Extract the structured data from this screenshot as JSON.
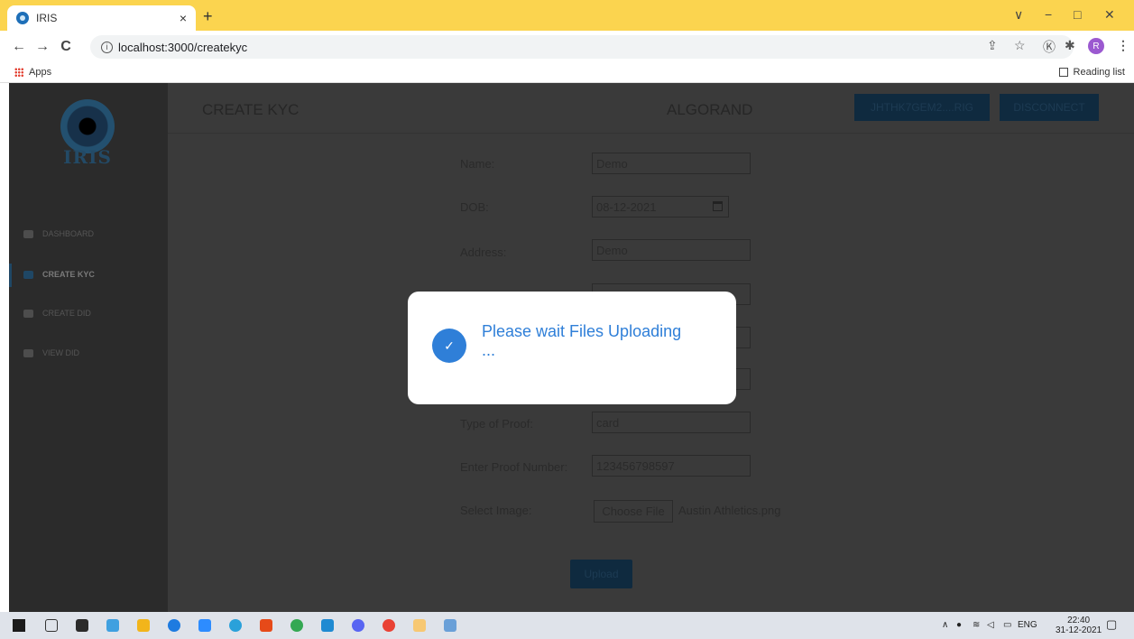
{
  "browser": {
    "tab_title": "IRIS",
    "tab_close": "×",
    "new_tab": "+",
    "url": "localhost:3000/createkyc",
    "nav": {
      "back": "←",
      "forward": "→",
      "reload": "C"
    },
    "window_controls": {
      "chevron": "∨",
      "minimize": "−",
      "restore": "□",
      "close": "✕"
    },
    "toolbar_icons": [
      "share-icon",
      "star-icon",
      "extension-icon",
      "puzzle-icon"
    ],
    "profile_initial": "R",
    "menu": "⋮",
    "bookmarks": {
      "apps_label": "Apps",
      "reading_list_label": "Reading list"
    }
  },
  "app": {
    "logo_text": "IRIS",
    "sidebar": {
      "items": [
        {
          "label": "DASHBOARD",
          "active": false
        },
        {
          "label": "CREATE KYC",
          "active": true
        },
        {
          "label": "CREATE DID",
          "active": false
        },
        {
          "label": "VIEW DID",
          "active": false
        }
      ]
    },
    "header": {
      "title": "CREATE KYC",
      "network": "ALGORAND",
      "address_button": "JHTHK7GEM2....RIG",
      "disconnect_button": "DISCONNECT"
    },
    "form": {
      "name_label": "Name:",
      "name_value": "Demo",
      "dob_label": "DOB:",
      "dob_value": "08-12-2021",
      "address_label": "Address:",
      "address_value": "Demo",
      "proof_type_label": "Type of Proof:",
      "proof_type_value": "card",
      "proof_number_label": "Enter Proof Number:",
      "proof_number_value": "123456798597",
      "image_label": "Select Image:",
      "choose_file_label": "Choose File",
      "file_name": "Austin Athletics.png",
      "upload_button": "Upload"
    },
    "modal": {
      "message": "Please wait Files Uploading ...",
      "icon": "check-icon"
    }
  },
  "taskbar": {
    "language": "ENG",
    "time": "22:40",
    "date": "31-12-2021"
  },
  "colors": {
    "tab_strip": "#fbd44f",
    "modal_accent": "#2f7fd8",
    "app_button": "#0f2a3f"
  }
}
